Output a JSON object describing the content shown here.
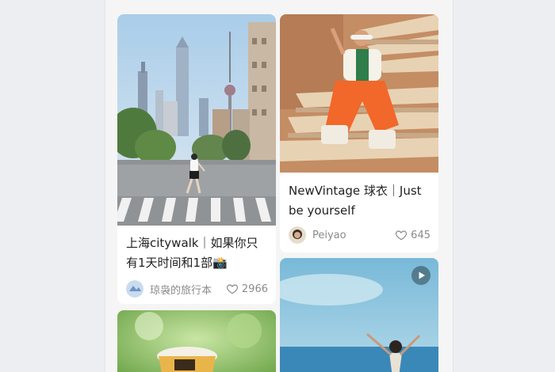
{
  "feed": {
    "cards": [
      {
        "title": "上海citywalk｜如果你只\n有1天时间和1部📸",
        "author": "琼袅的旅行本",
        "likes": "2966",
        "image_icon": "city-skyline-photo"
      },
      {
        "title": "NewVintage 球衣｜Just\nbe yourself",
        "author": "Peiyao",
        "likes": "645",
        "image_icon": "fashion-stairs-photo"
      },
      {
        "title": "",
        "author": "",
        "likes": "",
        "image_icon": "drink-cup-photo"
      },
      {
        "title": "",
        "author": "",
        "likes": "",
        "image_icon": "beach-dance-photo",
        "video_icon": "play-icon"
      }
    ]
  },
  "colors": {
    "page_bg": "#eceef1",
    "feed_bg": "#f5f5f5",
    "card_bg": "#ffffff",
    "title_text": "#222222",
    "meta_text": "#8a8a8a"
  }
}
